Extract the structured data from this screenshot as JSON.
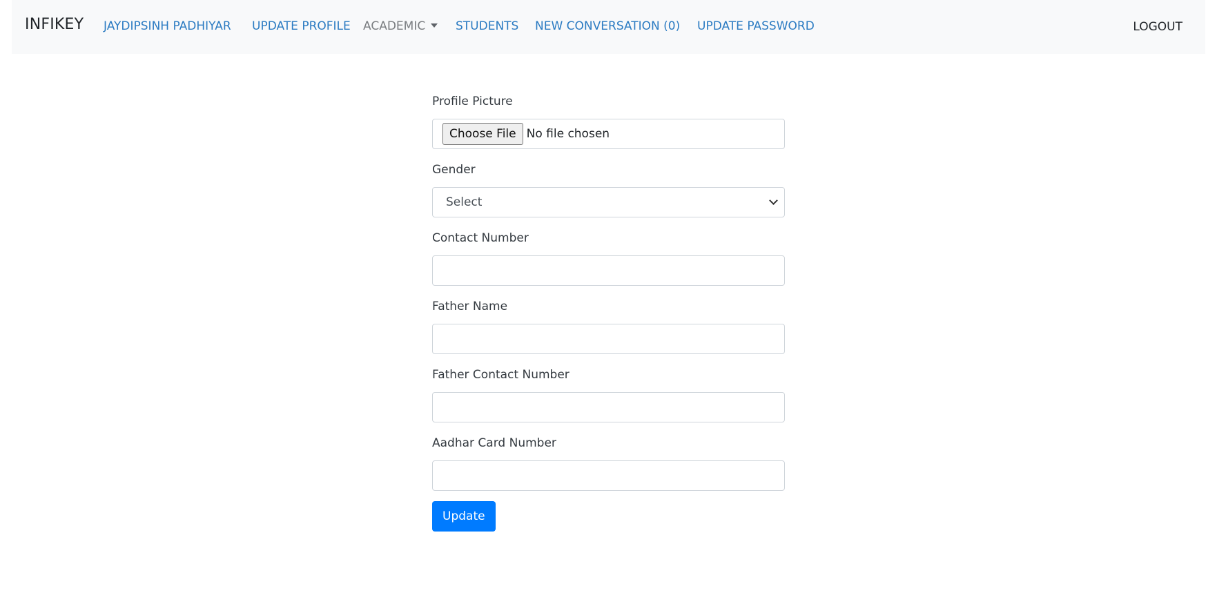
{
  "navbar": {
    "brand": "INFIKEY",
    "links": [
      {
        "label": "JAYDIPSINH PADHIYAR"
      },
      {
        "label": "UPDATE PROFILE"
      },
      {
        "label": "ACADEMIC"
      },
      {
        "label": "STUDENTS"
      },
      {
        "label": "NEW CONVERSATION (0)"
      },
      {
        "label": "UPDATE PASSWORD"
      }
    ],
    "logout": "LOGOUT"
  },
  "form": {
    "profile_picture": {
      "label": "Profile Picture",
      "button": "Choose File",
      "status": "No file chosen"
    },
    "gender": {
      "label": "Gender",
      "selected": "Select"
    },
    "contact_number": {
      "label": "Contact Number",
      "value": ""
    },
    "father_name": {
      "label": "Father Name",
      "value": ""
    },
    "father_contact_number": {
      "label": "Father Contact Number",
      "value": ""
    },
    "aadhar_card_number": {
      "label": "Aadhar Card Number",
      "value": ""
    },
    "submit_label": "Update"
  },
  "colors": {
    "link": "#2b7bc2",
    "primary": "#007bff",
    "navbar_bg": "#f8f9fa"
  }
}
